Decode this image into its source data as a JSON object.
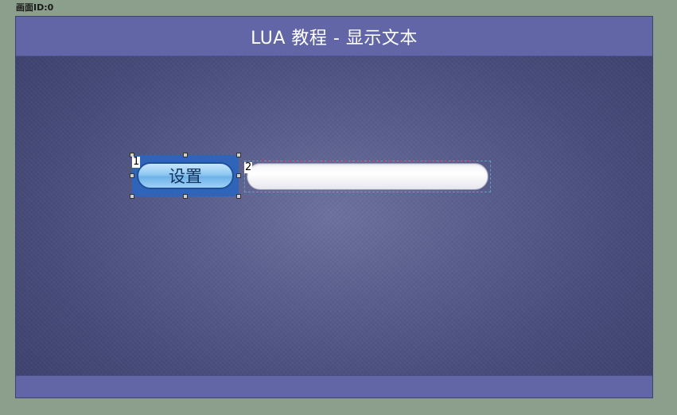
{
  "screen": {
    "id_label": "画面ID:0"
  },
  "title_bar": {
    "title": "LUA 教程 - 显示文本"
  },
  "widgets": {
    "button": {
      "label": "设置",
      "id_number": "1"
    },
    "text_display": {
      "value": "",
      "id_number": "2"
    }
  },
  "colors": {
    "background": "#8c9f8c",
    "title_bar": "#6266a6",
    "canvas": "#474c7a",
    "button_frame": "#2f64b8",
    "button_fill": "#8ec8f2"
  }
}
